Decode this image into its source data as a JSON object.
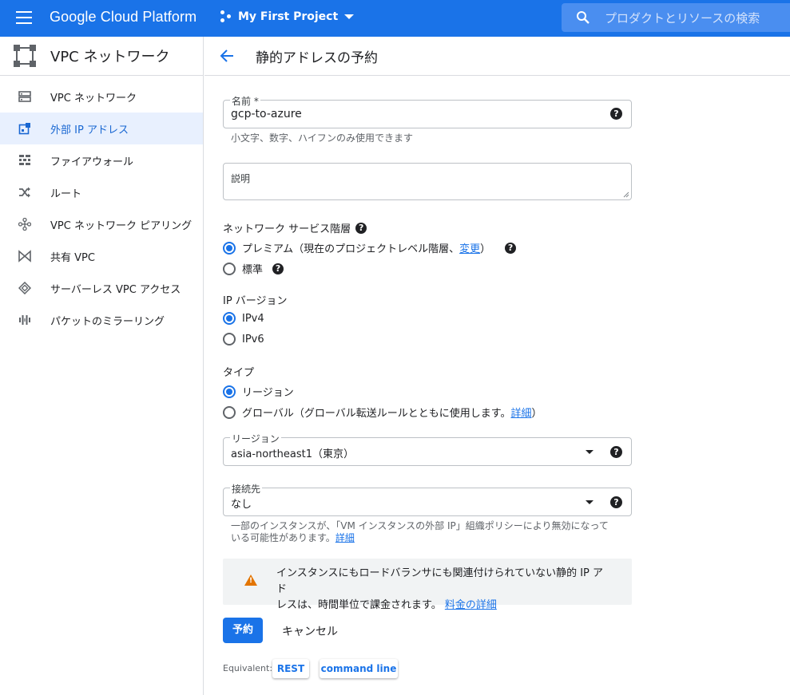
{
  "topbar": {
    "brand": "Google Cloud Platform",
    "project": "My First Project",
    "search_placeholder": "プロダクトとリソースの検索"
  },
  "sidebar": {
    "title": "VPC ネットワーク",
    "items": [
      {
        "label": "VPC ネットワーク",
        "icon": "vpc-network-icon"
      },
      {
        "label": "外部 IP アドレス",
        "icon": "external-ip-icon",
        "active": true
      },
      {
        "label": "ファイアウォール",
        "icon": "firewall-icon"
      },
      {
        "label": "ルート",
        "icon": "route-icon"
      },
      {
        "label": "VPC ネットワーク ピアリング",
        "icon": "peering-icon"
      },
      {
        "label": "共有 VPC",
        "icon": "shared-vpc-icon"
      },
      {
        "label": "サーバーレス VPC アクセス",
        "icon": "serverless-icon"
      },
      {
        "label": "パケットのミラーリング",
        "icon": "packet-mirroring-icon"
      }
    ]
  },
  "page": {
    "title": "静的アドレスの予約"
  },
  "form": {
    "name": {
      "label": "名前 *",
      "value": "gcp-to-azure",
      "hint": "小文字、数字、ハイフンのみ使用できます"
    },
    "description": {
      "placeholder": "説明"
    },
    "network_tier": {
      "label": "ネットワーク サービス階層",
      "options": [
        {
          "label": "プレミアム（現在のプロジェクトレベル階層、",
          "link": "変更",
          "suffix": "）",
          "checked": true
        },
        {
          "label": "標準",
          "checked": false
        }
      ]
    },
    "ip_version": {
      "label": "IP バージョン",
      "options": [
        {
          "label": "IPv4",
          "checked": true
        },
        {
          "label": "IPv6",
          "checked": false
        }
      ]
    },
    "type": {
      "label": "タイプ",
      "options": [
        {
          "label": "リージョン",
          "checked": true
        },
        {
          "label": "グローバル（グローバル転送ルールとともに使用します。",
          "link": "詳細",
          "suffix": "）",
          "checked": false
        }
      ]
    },
    "region": {
      "label": "リージョン",
      "value": "asia-northeast1（東京）"
    },
    "attached_to": {
      "label": "接続先",
      "value": "なし",
      "hint_line1": "一部のインスタンスが、「VM インスタンスの外部 IP」組織ポリシーにより無効になって",
      "hint_line2": "いる可能性があります。",
      "hint_link": "詳細"
    },
    "warning": {
      "line1": "インスタンスにもロードバランサにも関連付けられていない静的 IP アド",
      "line2": "レスは、時間単位で課金されます。",
      "link": "料金の詳細"
    },
    "reserve_button": "予約",
    "cancel_button": "キャンセル",
    "equivalent_label": "Equivalent:",
    "rest_button": "REST",
    "cli_button": "command line"
  },
  "colors": {
    "primary": "#1a73e8",
    "warning": "#e37400",
    "active_bg": "#e8f0fe"
  }
}
